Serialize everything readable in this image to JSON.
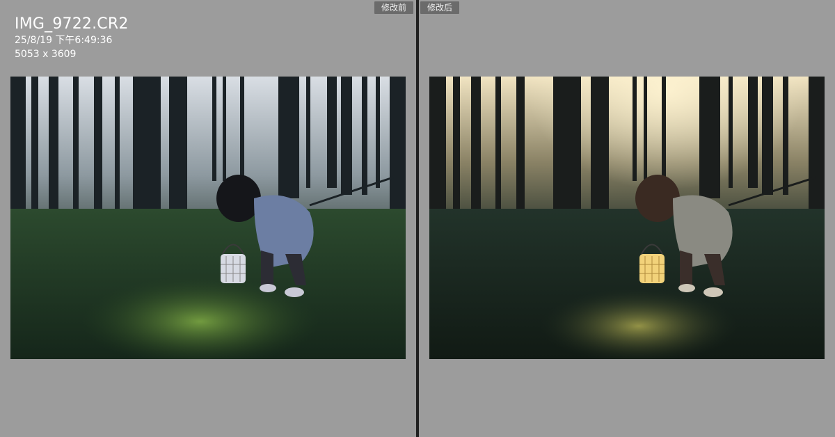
{
  "panels": {
    "before": {
      "label": "修改前",
      "file_name": "IMG_9722.CR2",
      "datetime": "25/8/19 下午6:49:36",
      "dimensions": "5053 x 3609"
    },
    "after": {
      "label": "修改后"
    }
  },
  "colors": {
    "panel_bg": "#9c9c9c",
    "divider": "#202020",
    "label_bg": "#6b6b6b"
  }
}
